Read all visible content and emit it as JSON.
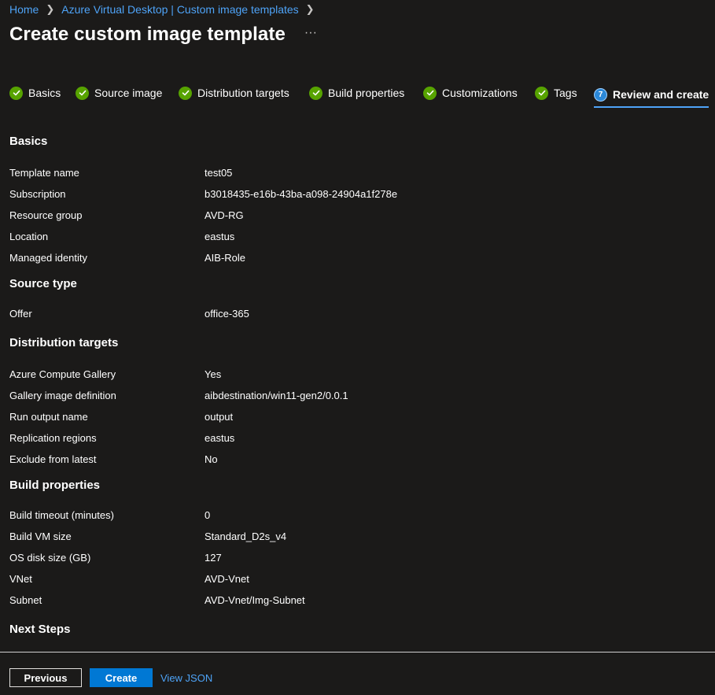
{
  "breadcrumb": {
    "items": [
      "Home",
      "Azure Virtual Desktop | Custom image templates"
    ],
    "separator": ">"
  },
  "header": {
    "title": "Create custom image template",
    "more": "···"
  },
  "tabs": [
    {
      "label": "Basics",
      "status": "complete"
    },
    {
      "label": "Source image",
      "status": "complete"
    },
    {
      "label": "Distribution targets",
      "status": "complete"
    },
    {
      "label": "Build properties",
      "status": "complete"
    },
    {
      "label": "Customizations",
      "status": "complete"
    },
    {
      "label": "Tags",
      "status": "complete"
    },
    {
      "label": "Review and create",
      "number": "7",
      "status": "active"
    }
  ],
  "sections": {
    "basics": {
      "title": "Basics",
      "rows": [
        {
          "label": "Template name",
          "value": "test05"
        },
        {
          "label": "Subscription",
          "value": "b3018435-e16b-43ba-a098-24904a1f278e"
        },
        {
          "label": "Resource group",
          "value": "AVD-RG"
        },
        {
          "label": "Location",
          "value": "eastus"
        },
        {
          "label": "Managed identity",
          "value": "AIB-Role"
        }
      ]
    },
    "source": {
      "title": "Source type",
      "rows": [
        {
          "label": "Offer",
          "value": "office-365"
        }
      ]
    },
    "distribution": {
      "title": "Distribution targets",
      "rows": [
        {
          "label": "Azure Compute Gallery",
          "value": "Yes"
        },
        {
          "label": "Gallery image definition",
          "value": "aibdestination/win11-gen2/0.0.1"
        },
        {
          "label": "Run output name",
          "value": "output"
        },
        {
          "label": "Replication regions",
          "value": "eastus"
        },
        {
          "label": "Exclude from latest",
          "value": "No"
        }
      ]
    },
    "build": {
      "title": "Build properties",
      "rows": [
        {
          "label": "Build timeout (minutes)",
          "value": "0"
        },
        {
          "label": "Build VM size",
          "value": "Standard_D2s_v4"
        },
        {
          "label": "OS disk size (GB)",
          "value": "127"
        },
        {
          "label": "VNet",
          "value": "AVD-Vnet"
        },
        {
          "label": "Subnet",
          "value": "AVD-Vnet/Img-Subnet"
        }
      ]
    },
    "next": {
      "title": "Next Steps"
    }
  },
  "footer": {
    "previous_label": "Previous",
    "create_label": "Create",
    "view_json_label": "View JSON"
  },
  "colors": {
    "background": "#1b1a19",
    "link": "#4ea3f7",
    "primary": "#0078d4",
    "success": "#57a300"
  }
}
